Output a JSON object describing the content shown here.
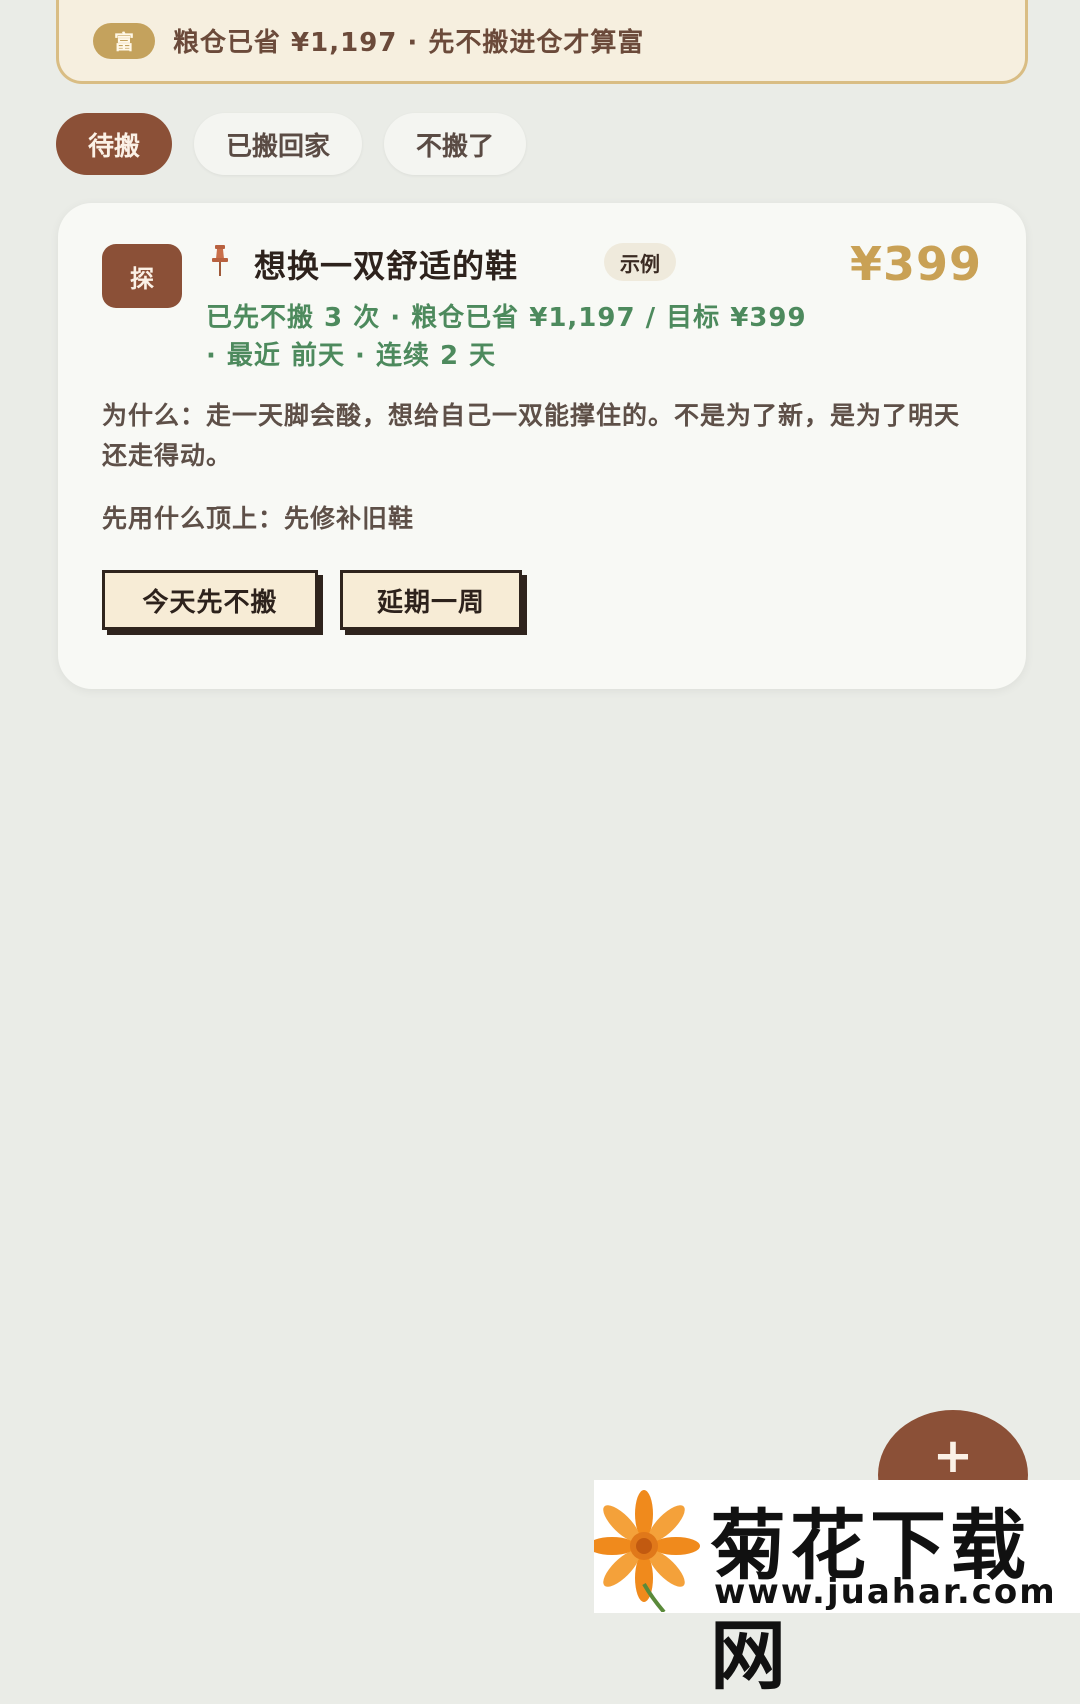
{
  "banner": {
    "badge": "富",
    "text": "粮仓已省 ¥1,197 · 先不搬进仓才算富"
  },
  "tabs": [
    {
      "label": "待搬",
      "active": true
    },
    {
      "label": "已搬回家",
      "active": false
    },
    {
      "label": "不搬了",
      "active": false
    }
  ],
  "card": {
    "avatar": "探",
    "pin_icon": "pushpin-icon",
    "title": "想换一双舒适的鞋",
    "tag": "示例",
    "price": "¥399",
    "stats": "已先不搬 3 次 · 粮仓已省 ¥1,197 / 目标 ¥399 · 最近 前天 · 连续 2 天",
    "why": "为什么：走一天脚会酸，想给自己一双能撑住的。不是为了新，是为了明天还走得动。",
    "fallback": "先用什么顶上：先修补旧鞋",
    "buttons": {
      "skip_today": "今天先不搬",
      "postpone": "延期一周"
    }
  },
  "fab": {
    "label": "+"
  },
  "watermark": {
    "title": "菊花下载网",
    "url": "www.juahar.com",
    "icon": "flower-icon"
  },
  "colors": {
    "accent": "#8b5037",
    "gold": "#c9a155",
    "green": "#4d8a5d",
    "background": "#eaece7"
  }
}
